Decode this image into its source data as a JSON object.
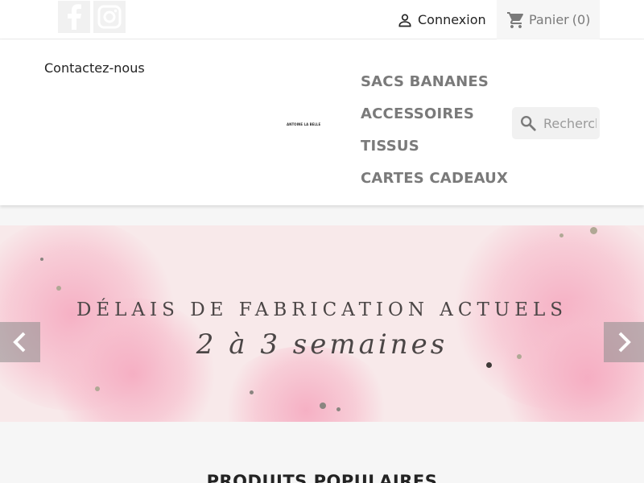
{
  "topbar": {
    "social": [
      {
        "name": "facebook",
        "icon": "facebook-icon"
      },
      {
        "name": "instagram",
        "icon": "instagram-icon"
      }
    ],
    "login_label": "Connexion",
    "cart_label": "Panier",
    "cart_count": "(0)"
  },
  "header": {
    "contact_label": "Contactez-nous",
    "logo_text": "ANTOINE LA BELLE",
    "menu": [
      "SACS BANANES",
      "ACCESSOIRES",
      "TISSUS",
      "CARTES CADEAUX"
    ],
    "search": {
      "placeholder": "Rechercher dans le catalogue",
      "value": ""
    }
  },
  "banner": {
    "title": "DÉLAIS DE FABRICATION ACTUELS",
    "subtitle": "2 à 3 semaines",
    "prev_icon": "chevron-left-icon",
    "next_icon": "chevron-right-icon"
  },
  "section": {
    "title": "PRODUITS POPULAIRES"
  },
  "colors": {
    "accent": "#7a7a7a",
    "banner_bg": "#f8e9ea",
    "blob": "#f5aac0",
    "text": "#232323"
  }
}
